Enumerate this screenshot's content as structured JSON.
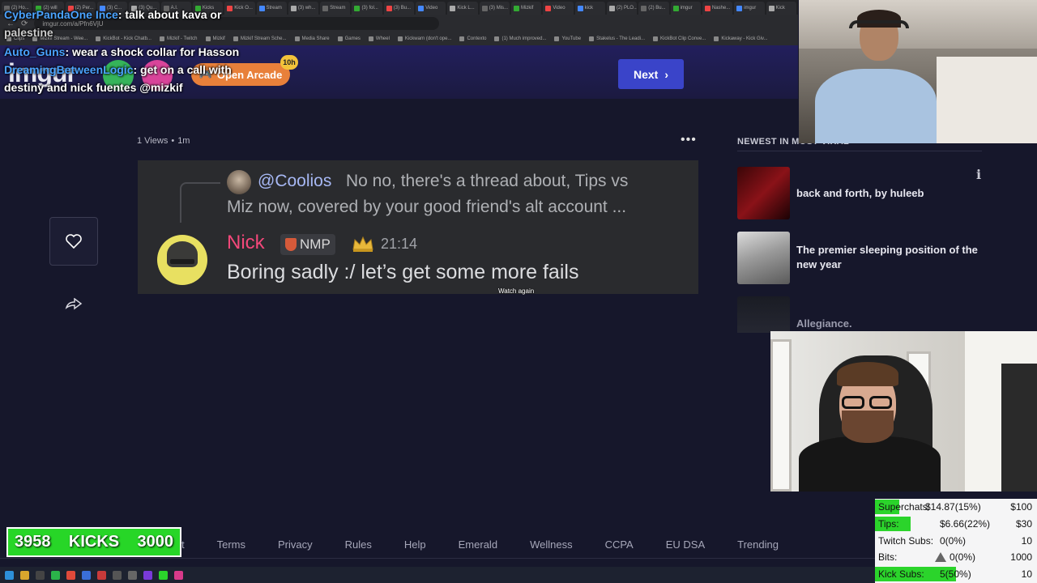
{
  "browser": {
    "tabs": [
      "(2) Ho...",
      "(2) will",
      "(2) Per...",
      "(3) C...",
      "(3) Qu...",
      "A.I.",
      "Kicks",
      "Kick O...",
      "Stream",
      "(3) wh...",
      "Stream",
      "(3) fol...",
      "(3) Bu...",
      "Video",
      "Kick L...",
      "(3) Mis...",
      "Mizkif",
      "Video",
      "kick",
      "(2) PLO...",
      "(2) Bu...",
      "imgur",
      "Nashe...",
      "imgur",
      "Kick"
    ],
    "url": "imgur.com/a/Pfn6VjU",
    "bookmarks": [
      "Clips",
      "Mizkif Stream - Wee...",
      "KickBot - Kick Chatb...",
      "Mizkif - Twitch",
      "Mizkif",
      "Mizkif Stream Sche...",
      "Media Share",
      "Games",
      "Wheel",
      "Kickwarn (don't ope...",
      "Contexto",
      "(1) Much improved...",
      "YouTube",
      "Stakelus - The Leadi...",
      "KickBot Clip Conve...",
      "Kickaway - Kick Giv..."
    ]
  },
  "header": {
    "logo": "imgur",
    "arcade_label": "Open Arcade",
    "arcade_count": "10h",
    "next_label": "Next"
  },
  "chat": {
    "line1_user": "CyberPandaOne Ince",
    "line1_text": ": talk about kava or",
    "line2_text": "palestine",
    "line3_user": "Auto_Guns",
    "line3_text": ": wear a shock collar for Hasson",
    "line4_user": "DreamingBetweenLogic",
    "line4_text": ": get on a call with",
    "line5_text": "destiny and nick fuentes @mizkif"
  },
  "post": {
    "views": "1 Views",
    "bullet": "•",
    "age": "1m",
    "quote_user": "@Coolios",
    "quote_line1": "No no, there's a thread about, Tips vs",
    "quote_line2": "Miz now, covered by your good friend's alt account ...",
    "author": "Nick",
    "role": "NMP",
    "time": "21:14",
    "message": "Boring sadly :/ let’s get some more fails",
    "watch_again": "Watch again"
  },
  "sidebar": {
    "title": "NEWEST IN MOST VIRAL",
    "items": [
      {
        "title": "back and forth, by huleeb"
      },
      {
        "title": "The premier sleeping position of the new year"
      },
      {
        "title": "Allegiance."
      }
    ]
  },
  "footer": {
    "links": [
      "t",
      "Terms",
      "Privacy",
      "Rules",
      "Help",
      "Emerald",
      "Wellness",
      "CCPA",
      "EU DSA",
      "Trending"
    ]
  },
  "kicks": {
    "count": "3958",
    "label": "KICKS",
    "goal": "3000"
  },
  "stats": {
    "rows": [
      {
        "label": "Superchats:",
        "value": "$14.87(15%)",
        "goal": "$100",
        "fill": 0.15
      },
      {
        "label": "Tips:",
        "value": "$6.66(22%)",
        "goal": "$30",
        "fill": 0.22
      },
      {
        "label": "Twitch Subs:",
        "value": "0(0%)",
        "goal": "10",
        "fill": 0
      },
      {
        "label": "Bits:",
        "value": "0(0%)",
        "goal": "1000",
        "fill": 0
      },
      {
        "label": "Kick Subs:",
        "value": "5(50%)",
        "goal": "10",
        "fill": 0.5
      }
    ]
  },
  "colors": {
    "accent": "#3a44c9",
    "kick_green": "#2bd42b",
    "nick_pink": "#f3487a",
    "arcade_orange": "#e8803a"
  }
}
